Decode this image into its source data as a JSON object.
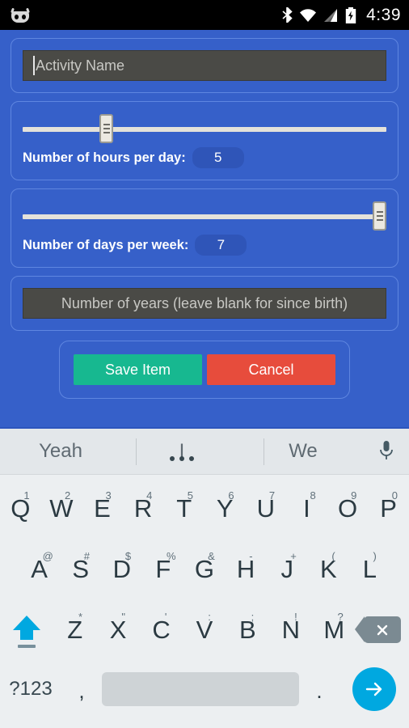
{
  "statusbar": {
    "time": "4:39",
    "icons": [
      "cyanogenmod-logo",
      "bluetooth-icon",
      "wifi-icon",
      "cellular-signal-icon",
      "battery-charging-icon"
    ]
  },
  "form": {
    "activity_name": {
      "placeholder": "Activity Name",
      "value": ""
    },
    "hours": {
      "label": "Number of hours per day:",
      "value": "5",
      "slider_percent": 22
    },
    "days": {
      "label": "Number of days per week:",
      "value": "7",
      "slider_percent": 100
    },
    "years": {
      "placeholder": "Number of years (leave blank for since birth)",
      "value": ""
    },
    "save_label": "Save Item",
    "cancel_label": "Cancel"
  },
  "keyboard": {
    "suggestions": [
      "Yeah",
      "I",
      "We"
    ],
    "mic": "microphone-icon",
    "row1": [
      {
        "k": "Q",
        "s": "1"
      },
      {
        "k": "W",
        "s": "2"
      },
      {
        "k": "E",
        "s": "3"
      },
      {
        "k": "R",
        "s": "4"
      },
      {
        "k": "T",
        "s": "5"
      },
      {
        "k": "Y",
        "s": "6"
      },
      {
        "k": "U",
        "s": "7"
      },
      {
        "k": "I",
        "s": "8"
      },
      {
        "k": "O",
        "s": "9"
      },
      {
        "k": "P",
        "s": "0"
      }
    ],
    "row2": [
      {
        "k": "A",
        "s": "@"
      },
      {
        "k": "S",
        "s": "#"
      },
      {
        "k": "D",
        "s": "$"
      },
      {
        "k": "F",
        "s": "%"
      },
      {
        "k": "G",
        "s": "&"
      },
      {
        "k": "H",
        "s": "-"
      },
      {
        "k": "J",
        "s": "+"
      },
      {
        "k": "K",
        "s": "("
      },
      {
        "k": "L",
        "s": ")"
      }
    ],
    "row3": [
      {
        "k": "Z",
        "s": "*"
      },
      {
        "k": "X",
        "s": "\""
      },
      {
        "k": "C",
        "s": "'"
      },
      {
        "k": "V",
        "s": ":"
      },
      {
        "k": "B",
        "s": ";"
      },
      {
        "k": "N",
        "s": "!"
      },
      {
        "k": "M",
        "s": "?"
      }
    ],
    "shift": "shift-icon",
    "backspace": "backspace-icon",
    "symbols_label": "?123",
    "comma": ",",
    "period": ".",
    "enter": "enter-arrow-icon"
  },
  "colors": {
    "background": "#3660c9",
    "card_border": "#5f86e0",
    "field": "#4a4a46",
    "save": "#17b890",
    "cancel": "#e74c3c",
    "keyboard_bg": "#eceff1",
    "accent_cyan": "#00a8e0"
  }
}
